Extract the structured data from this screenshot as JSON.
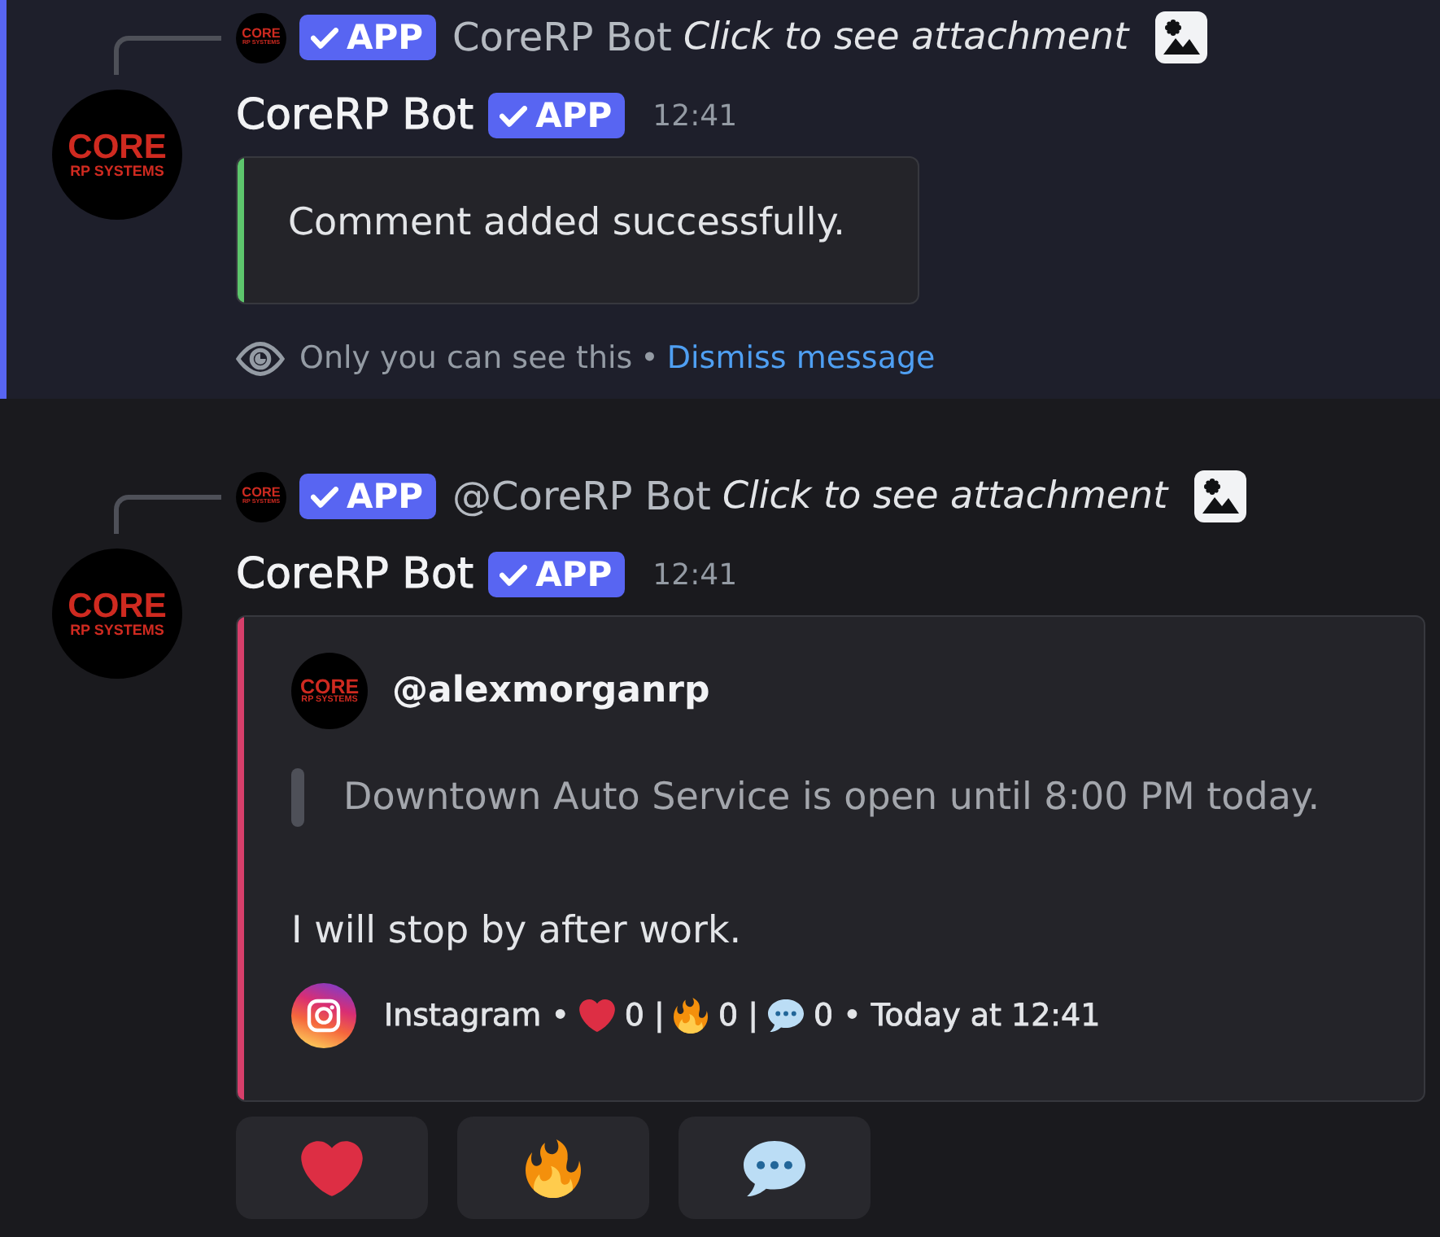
{
  "messages": [
    {
      "ephemeral": true,
      "reply": {
        "avatar": {
          "line_1": "CORE",
          "line_2": "RP SYSTEMS"
        },
        "badge": "APP",
        "author": "CoreRP Bot",
        "content": "Click to see attachment"
      },
      "avatar": {
        "line_1": "CORE",
        "line_2": "RP SYSTEMS"
      },
      "author": "CoreRP Bot",
      "badge": "APP",
      "timestamp": "12:41",
      "embed": {
        "color": "#5dc66c",
        "description": "Comment added successfully."
      },
      "notice": {
        "text": "Only you can see this",
        "separator": "•",
        "link": "Dismiss message"
      }
    },
    {
      "ephemeral": false,
      "reply": {
        "avatar": {
          "line_1": "CORE",
          "line_2": "RP SYSTEMS"
        },
        "badge": "APP",
        "author": "@CoreRP Bot",
        "content": "Click to see attachment"
      },
      "avatar": {
        "line_1": "CORE",
        "line_2": "RP SYSTEMS"
      },
      "author": "CoreRP Bot",
      "badge": "APP",
      "timestamp": "12:41",
      "embed": {
        "color": "#d73f6b",
        "author": {
          "avatar": {
            "line_1": "CORE",
            "line_2": "RP SYSTEMS"
          },
          "name": "@alexmorganrp"
        },
        "quote": "Downtown Auto Service is open until 8:00 PM today.",
        "description": "I will stop by after work.",
        "footer": {
          "parts": [
            {
              "kind": "text",
              "text": "Instagram •"
            },
            {
              "kind": "heart"
            },
            {
              "kind": "text",
              "text": "0 |"
            },
            {
              "kind": "fire"
            },
            {
              "kind": "text",
              "text": "0 |"
            },
            {
              "kind": "bubble"
            },
            {
              "kind": "text",
              "text": "0 • Today at 12:41"
            }
          ]
        }
      },
      "buttons": [
        {
          "kind": "heart"
        },
        {
          "kind": "fire"
        },
        {
          "kind": "bubble"
        }
      ]
    }
  ]
}
